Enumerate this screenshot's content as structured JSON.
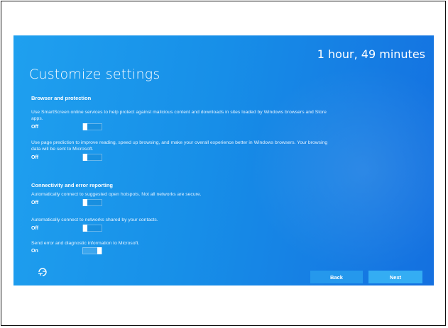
{
  "timer": "1 hour, 49 minutes",
  "title": "Customize settings",
  "sections": [
    {
      "heading": "Browser and protection",
      "settings": [
        {
          "description": "Use SmartScreen online services to help protect against malicious content and downloads in sites loaded by Windows browsers and Store apps.",
          "state": "Off"
        },
        {
          "description": "Use page prediction to improve reading, speed up browsing, and make your overall experience better in Windows browsers. Your browsing data will be sent to Microsoft.",
          "state": "Off"
        }
      ]
    },
    {
      "heading": "Connectivity and error reporting",
      "settings": [
        {
          "description": "Automatically connect to suggested open hotspots. Not all networks are secure.",
          "state": "Off"
        },
        {
          "description": "Automatically connect to networks shared by your contacts.",
          "state": "Off"
        },
        {
          "description": "Send error and diagnostic information to Microsoft.",
          "state": "On"
        }
      ]
    }
  ],
  "buttons": {
    "back": "Back",
    "next": "Next"
  },
  "icons": {
    "accessibility": "ease-of-access-icon"
  },
  "colors": {
    "background": "#178fe8",
    "back_button": "#2598ec",
    "next_button": "#34adf3",
    "text": "#ffffff"
  }
}
